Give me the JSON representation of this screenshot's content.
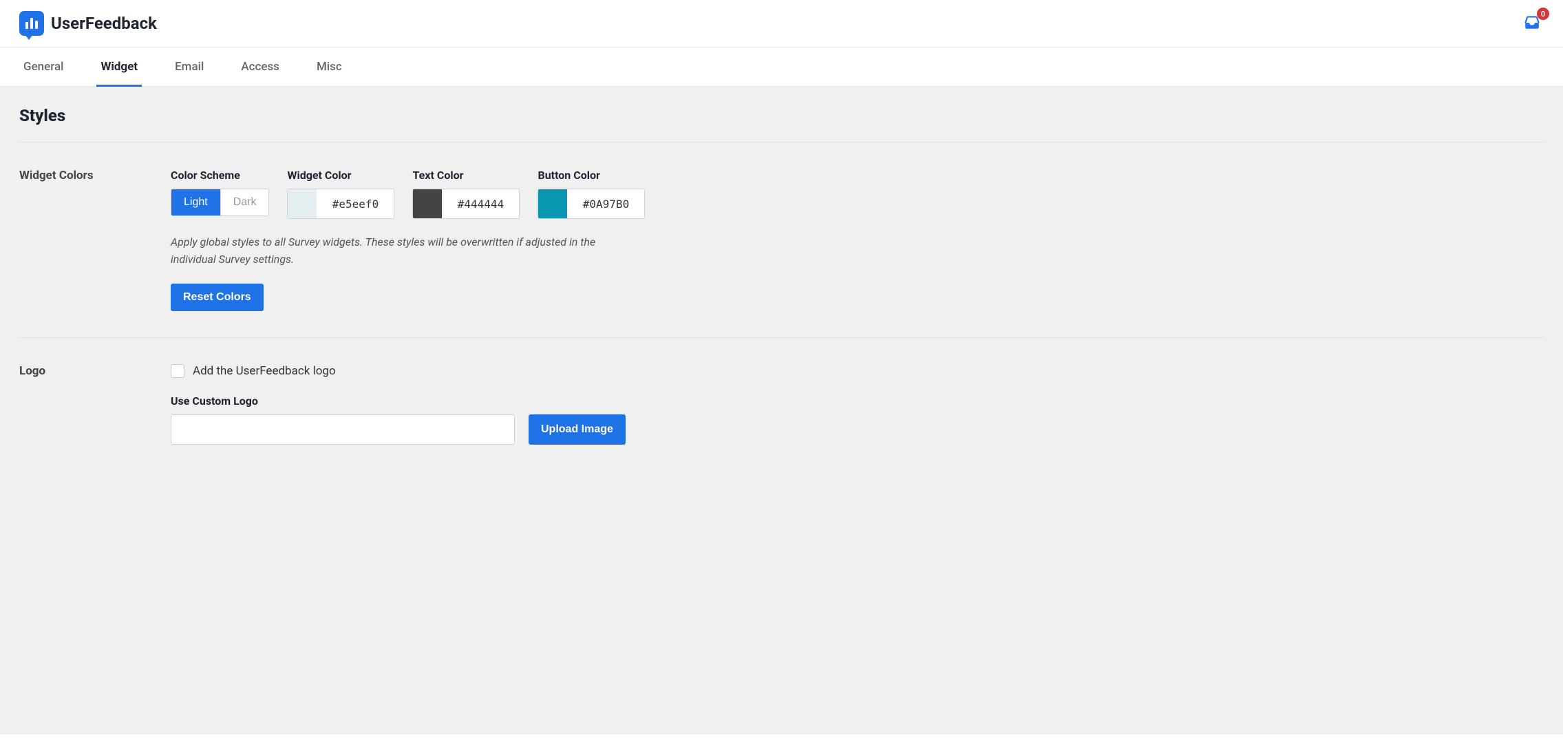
{
  "brand": {
    "name": "UserFeedback"
  },
  "header": {
    "inbox_count": "0"
  },
  "tabs": [
    {
      "label": "General",
      "active": false
    },
    {
      "label": "Widget",
      "active": true
    },
    {
      "label": "Email",
      "active": false
    },
    {
      "label": "Access",
      "active": false
    },
    {
      "label": "Misc",
      "active": false
    }
  ],
  "page": {
    "title": "Styles"
  },
  "widget_colors": {
    "section_label": "Widget Colors",
    "scheme": {
      "label": "Color Scheme",
      "options": [
        "Light",
        "Dark"
      ],
      "active": "Light"
    },
    "widget": {
      "label": "Widget Color",
      "value": "#e5eef0",
      "swatch": "#e5eef0"
    },
    "text": {
      "label": "Text Color",
      "value": "#444444",
      "swatch": "#444444"
    },
    "button": {
      "label": "Button Color",
      "value": "#0A97B0",
      "swatch": "#0A97B0"
    },
    "help": "Apply global styles to all Survey widgets. These styles will be overwritten if adjusted in the individual Survey settings.",
    "reset_label": "Reset Colors"
  },
  "logo": {
    "section_label": "Logo",
    "add_logo_label": "Add the UserFeedback logo",
    "custom_label": "Use Custom Logo",
    "custom_value": "",
    "upload_label": "Upload Image"
  }
}
